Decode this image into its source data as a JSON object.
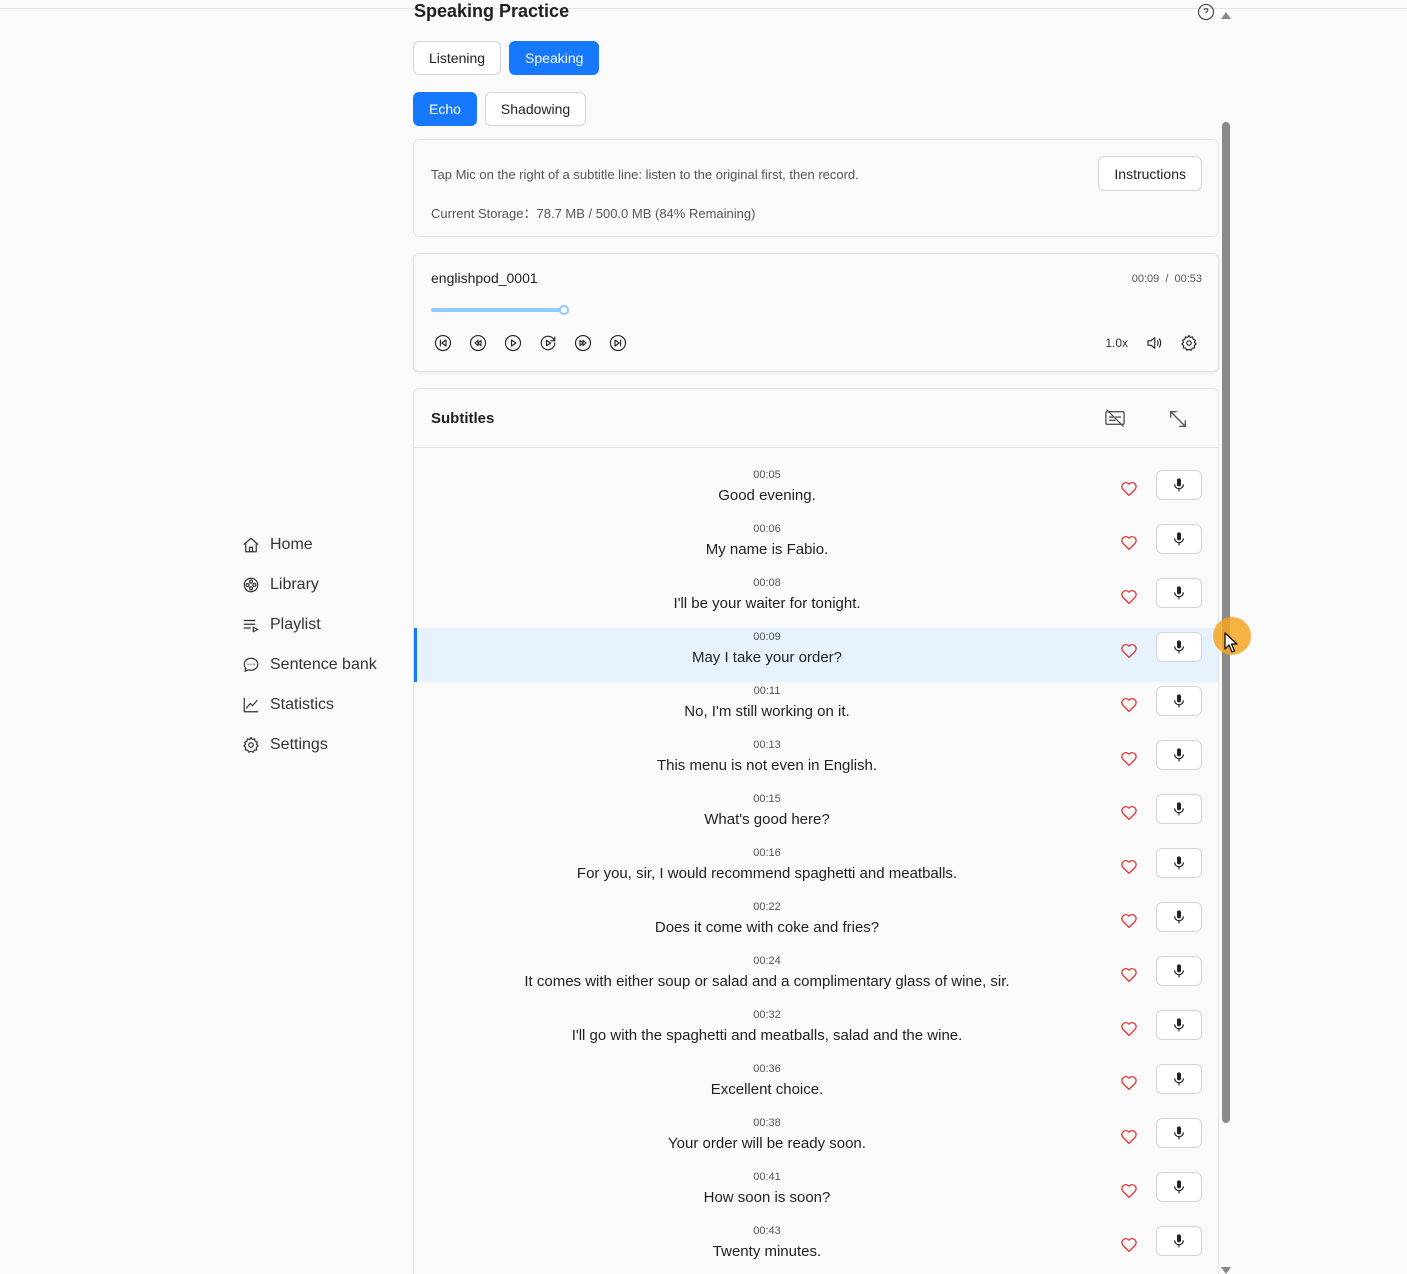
{
  "page": {
    "title": "Speaking Practice"
  },
  "sidebar": {
    "items": [
      {
        "label": "Home",
        "icon": "home-icon"
      },
      {
        "label": "Library",
        "icon": "film-reel-icon"
      },
      {
        "label": "Playlist",
        "icon": "playlist-icon"
      },
      {
        "label": "Sentence bank",
        "icon": "chat-bubble-icon"
      },
      {
        "label": "Statistics",
        "icon": "line-chart-icon"
      },
      {
        "label": "Settings",
        "icon": "gear-icon"
      }
    ]
  },
  "mode_tabs": {
    "listening": "Listening",
    "speaking": "Speaking",
    "active": "Speaking"
  },
  "sub_tabs": {
    "echo": "Echo",
    "shadowing": "Shadowing",
    "active": "Echo"
  },
  "info": {
    "text": "Tap Mic on the right of a subtitle line: listen to the original first, then record.",
    "storage": "Current Storage：78.7 MB / 500.0 MB (84% Remaining)",
    "instructions_button": "Instructions"
  },
  "player": {
    "track": "englishpod_0001",
    "current_time": "00:09",
    "separator": "/",
    "duration": "00:53",
    "progress": 0.17,
    "speed": "1.0x"
  },
  "subtitles": {
    "title": "Subtitles",
    "active_index": 3,
    "lines": [
      {
        "time": "00:05",
        "text": "Good evening."
      },
      {
        "time": "00:06",
        "text": "My name is Fabio."
      },
      {
        "time": "00:08",
        "text": "I'll be your waiter for tonight."
      },
      {
        "time": "00:09",
        "text": "May I take your order?"
      },
      {
        "time": "00:11",
        "text": "No, I'm still working on it."
      },
      {
        "time": "00:13",
        "text": "This menu is not even in English."
      },
      {
        "time": "00:15",
        "text": "What's good here?"
      },
      {
        "time": "00:16",
        "text": "For you, sir, I would recommend spaghetti and meatballs."
      },
      {
        "time": "00:22",
        "text": "Does it come with coke and fries?"
      },
      {
        "time": "00:24",
        "text": "It comes with either soup or salad and a complimentary glass of wine, sir."
      },
      {
        "time": "00:32",
        "text": "I'll go with the spaghetti and meatballs, salad and the wine."
      },
      {
        "time": "00:36",
        "text": "Excellent choice."
      },
      {
        "time": "00:38",
        "text": "Your order will be ready soon."
      },
      {
        "time": "00:41",
        "text": "How soon is soon?"
      },
      {
        "time": "00:43",
        "text": "Twenty minutes."
      }
    ]
  },
  "colors": {
    "accent": "#1677ff",
    "heart": "#e53935",
    "active_row": "#e6f2ff"
  }
}
